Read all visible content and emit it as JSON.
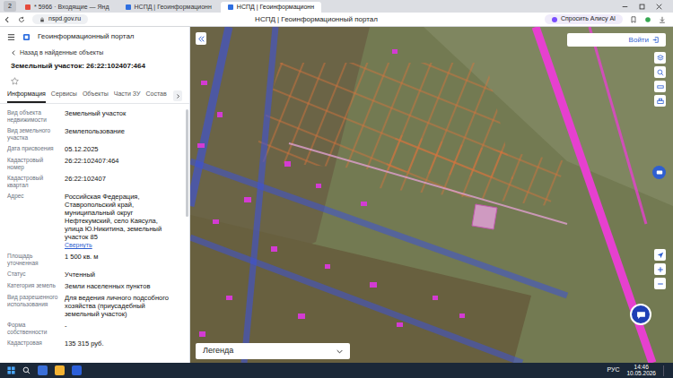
{
  "browser": {
    "counter": "2",
    "tabs": [
      {
        "label": "* 5966 · Входящие — Янд",
        "selected": false
      },
      {
        "label": "НСПД | Геоинформационн",
        "selected": false
      },
      {
        "label": "НСПД | Геоинформационн",
        "selected": true
      }
    ],
    "address": "nspd.gov.ru",
    "title": "НСПД | Геоинформационный портал",
    "alice": "Спросить Алису AI"
  },
  "portal": {
    "title": "Геоинформационный портал"
  },
  "panel": {
    "back": "Назад в найденные объекты",
    "heading": "Земельный участок: 26:22:102407:464",
    "favorite": false,
    "tabs": [
      {
        "label": "Информация",
        "selected": true
      },
      {
        "label": "Сервисы",
        "selected": false
      },
      {
        "label": "Объекты",
        "selected": false
      },
      {
        "label": "Части ЗУ",
        "selected": false
      },
      {
        "label": "Состав",
        "selected": false
      }
    ],
    "fields": [
      {
        "label": "Вид объекта недвижимости",
        "value": "Земельный участок"
      },
      {
        "label": "Вид земельного участка",
        "value": "Землепользование"
      },
      {
        "label": "Дата присвоения",
        "value": "05.12.2025"
      },
      {
        "label": "Кадастровый номер",
        "value": "26:22:102407:464"
      },
      {
        "label": "Кадастровый квартал",
        "value": "26:22:102407"
      },
      {
        "label": "Адрес",
        "value": "Российская Федерация, Ставропольский край, муниципальный округ Нефтекумский, село Каясула, улица Ю.Никитина, земельный участок 85",
        "action": "Свернуть"
      },
      {
        "label": "Площадь уточненная",
        "value": "1 500 кв. м"
      },
      {
        "label": "Статус",
        "value": "Учтенный"
      },
      {
        "label": "Категория земель",
        "value": "Земли населенных пунктов"
      },
      {
        "label": "Вид разрешенного использования",
        "value": "Для ведения личного подсобного хозяйства (приусадебный земельный участок)"
      },
      {
        "label": "Форма собственности",
        "value": "-"
      },
      {
        "label": "Кадастровая",
        "value": "135 315 руб."
      }
    ]
  },
  "map": {
    "login": "Войти",
    "legend": "Легенда"
  },
  "taskbar": {
    "lang": "РУС",
    "time": "14:46",
    "date": "10.05.2026"
  }
}
